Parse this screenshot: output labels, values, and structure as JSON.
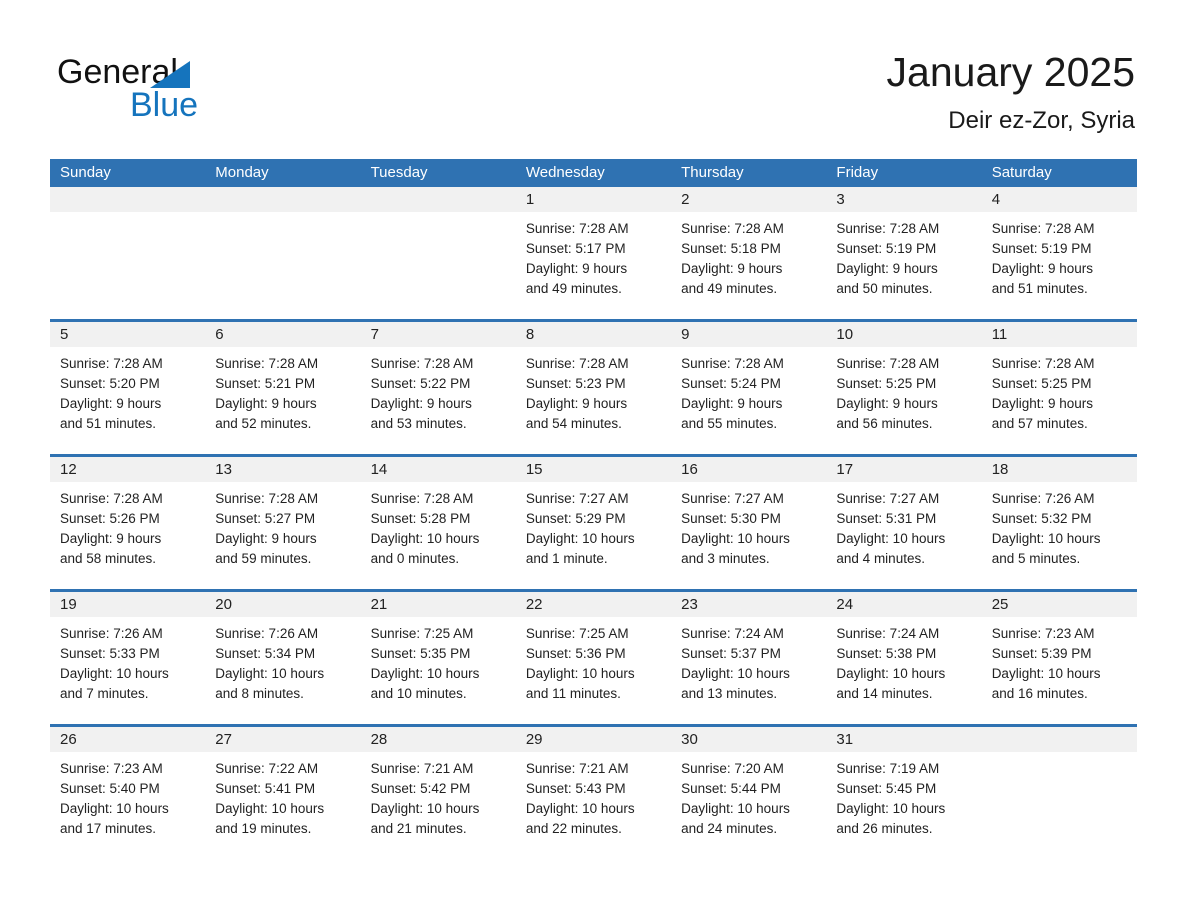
{
  "logo": {
    "word_one": "General",
    "word_two": "Blue",
    "triangle_icon": "triangle-icon",
    "brand_blue": "#1574bd"
  },
  "header": {
    "month_title": "January 2025",
    "location": "Deir ez-Zor, Syria"
  },
  "colors": {
    "header_blue": "#2f72b2",
    "day_band_gray": "#f1f1f1",
    "text": "#222222"
  },
  "calendar": {
    "day_names": [
      "Sunday",
      "Monday",
      "Tuesday",
      "Wednesday",
      "Thursday",
      "Friday",
      "Saturday"
    ],
    "weeks": [
      [
        {
          "day": "",
          "lines": []
        },
        {
          "day": "",
          "lines": []
        },
        {
          "day": "",
          "lines": []
        },
        {
          "day": "1",
          "lines": [
            "Sunrise: 7:28 AM",
            "Sunset: 5:17 PM",
            "Daylight: 9 hours",
            "and 49 minutes."
          ]
        },
        {
          "day": "2",
          "lines": [
            "Sunrise: 7:28 AM",
            "Sunset: 5:18 PM",
            "Daylight: 9 hours",
            "and 49 minutes."
          ]
        },
        {
          "day": "3",
          "lines": [
            "Sunrise: 7:28 AM",
            "Sunset: 5:19 PM",
            "Daylight: 9 hours",
            "and 50 minutes."
          ]
        },
        {
          "day": "4",
          "lines": [
            "Sunrise: 7:28 AM",
            "Sunset: 5:19 PM",
            "Daylight: 9 hours",
            "and 51 minutes."
          ]
        }
      ],
      [
        {
          "day": "5",
          "lines": [
            "Sunrise: 7:28 AM",
            "Sunset: 5:20 PM",
            "Daylight: 9 hours",
            "and 51 minutes."
          ]
        },
        {
          "day": "6",
          "lines": [
            "Sunrise: 7:28 AM",
            "Sunset: 5:21 PM",
            "Daylight: 9 hours",
            "and 52 minutes."
          ]
        },
        {
          "day": "7",
          "lines": [
            "Sunrise: 7:28 AM",
            "Sunset: 5:22 PM",
            "Daylight: 9 hours",
            "and 53 minutes."
          ]
        },
        {
          "day": "8",
          "lines": [
            "Sunrise: 7:28 AM",
            "Sunset: 5:23 PM",
            "Daylight: 9 hours",
            "and 54 minutes."
          ]
        },
        {
          "day": "9",
          "lines": [
            "Sunrise: 7:28 AM",
            "Sunset: 5:24 PM",
            "Daylight: 9 hours",
            "and 55 minutes."
          ]
        },
        {
          "day": "10",
          "lines": [
            "Sunrise: 7:28 AM",
            "Sunset: 5:25 PM",
            "Daylight: 9 hours",
            "and 56 minutes."
          ]
        },
        {
          "day": "11",
          "lines": [
            "Sunrise: 7:28 AM",
            "Sunset: 5:25 PM",
            "Daylight: 9 hours",
            "and 57 minutes."
          ]
        }
      ],
      [
        {
          "day": "12",
          "lines": [
            "Sunrise: 7:28 AM",
            "Sunset: 5:26 PM",
            "Daylight: 9 hours",
            "and 58 minutes."
          ]
        },
        {
          "day": "13",
          "lines": [
            "Sunrise: 7:28 AM",
            "Sunset: 5:27 PM",
            "Daylight: 9 hours",
            "and 59 minutes."
          ]
        },
        {
          "day": "14",
          "lines": [
            "Sunrise: 7:28 AM",
            "Sunset: 5:28 PM",
            "Daylight: 10 hours",
            "and 0 minutes."
          ]
        },
        {
          "day": "15",
          "lines": [
            "Sunrise: 7:27 AM",
            "Sunset: 5:29 PM",
            "Daylight: 10 hours",
            "and 1 minute."
          ]
        },
        {
          "day": "16",
          "lines": [
            "Sunrise: 7:27 AM",
            "Sunset: 5:30 PM",
            "Daylight: 10 hours",
            "and 3 minutes."
          ]
        },
        {
          "day": "17",
          "lines": [
            "Sunrise: 7:27 AM",
            "Sunset: 5:31 PM",
            "Daylight: 10 hours",
            "and 4 minutes."
          ]
        },
        {
          "day": "18",
          "lines": [
            "Sunrise: 7:26 AM",
            "Sunset: 5:32 PM",
            "Daylight: 10 hours",
            "and 5 minutes."
          ]
        }
      ],
      [
        {
          "day": "19",
          "lines": [
            "Sunrise: 7:26 AM",
            "Sunset: 5:33 PM",
            "Daylight: 10 hours",
            "and 7 minutes."
          ]
        },
        {
          "day": "20",
          "lines": [
            "Sunrise: 7:26 AM",
            "Sunset: 5:34 PM",
            "Daylight: 10 hours",
            "and 8 minutes."
          ]
        },
        {
          "day": "21",
          "lines": [
            "Sunrise: 7:25 AM",
            "Sunset: 5:35 PM",
            "Daylight: 10 hours",
            "and 10 minutes."
          ]
        },
        {
          "day": "22",
          "lines": [
            "Sunrise: 7:25 AM",
            "Sunset: 5:36 PM",
            "Daylight: 10 hours",
            "and 11 minutes."
          ]
        },
        {
          "day": "23",
          "lines": [
            "Sunrise: 7:24 AM",
            "Sunset: 5:37 PM",
            "Daylight: 10 hours",
            "and 13 minutes."
          ]
        },
        {
          "day": "24",
          "lines": [
            "Sunrise: 7:24 AM",
            "Sunset: 5:38 PM",
            "Daylight: 10 hours",
            "and 14 minutes."
          ]
        },
        {
          "day": "25",
          "lines": [
            "Sunrise: 7:23 AM",
            "Sunset: 5:39 PM",
            "Daylight: 10 hours",
            "and 16 minutes."
          ]
        }
      ],
      [
        {
          "day": "26",
          "lines": [
            "Sunrise: 7:23 AM",
            "Sunset: 5:40 PM",
            "Daylight: 10 hours",
            "and 17 minutes."
          ]
        },
        {
          "day": "27",
          "lines": [
            "Sunrise: 7:22 AM",
            "Sunset: 5:41 PM",
            "Daylight: 10 hours",
            "and 19 minutes."
          ]
        },
        {
          "day": "28",
          "lines": [
            "Sunrise: 7:21 AM",
            "Sunset: 5:42 PM",
            "Daylight: 10 hours",
            "and 21 minutes."
          ]
        },
        {
          "day": "29",
          "lines": [
            "Sunrise: 7:21 AM",
            "Sunset: 5:43 PM",
            "Daylight: 10 hours",
            "and 22 minutes."
          ]
        },
        {
          "day": "30",
          "lines": [
            "Sunrise: 7:20 AM",
            "Sunset: 5:44 PM",
            "Daylight: 10 hours",
            "and 24 minutes."
          ]
        },
        {
          "day": "31",
          "lines": [
            "Sunrise: 7:19 AM",
            "Sunset: 5:45 PM",
            "Daylight: 10 hours",
            "and 26 minutes."
          ]
        },
        {
          "day": "",
          "lines": []
        }
      ]
    ]
  }
}
